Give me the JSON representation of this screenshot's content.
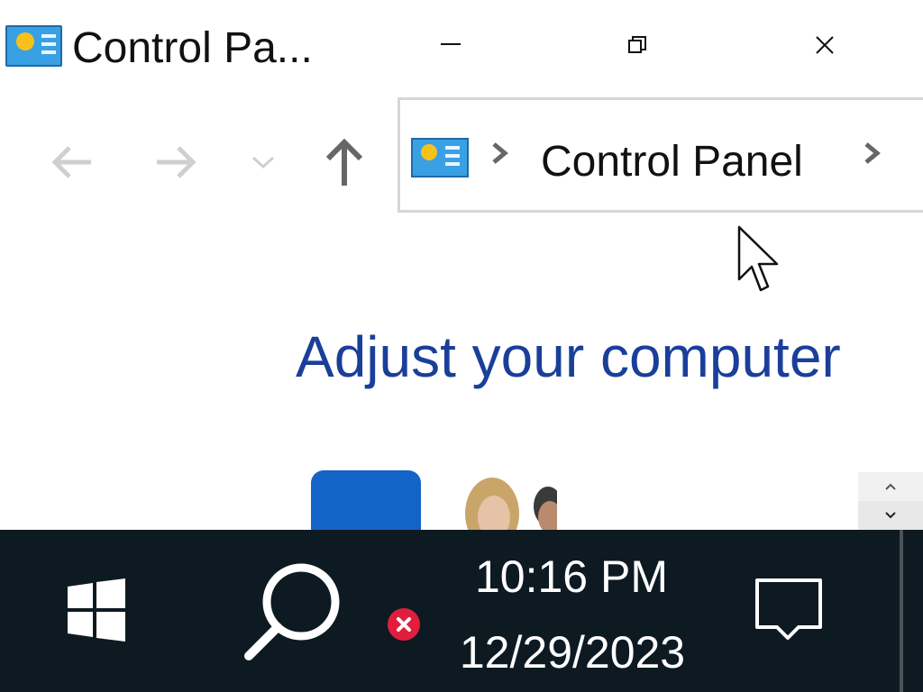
{
  "window": {
    "title": "Control Pa...",
    "minimize_icon": "minimize-icon",
    "restore_icon": "restore-icon",
    "close_icon": "close-icon"
  },
  "nav": {
    "back_icon": "arrow-left-icon",
    "forward_icon": "arrow-right-icon",
    "recent_icon": "chevron-down-icon",
    "up_icon": "arrow-up-icon"
  },
  "address_bar": {
    "icon": "control-panel-icon",
    "breadcrumb": "Control Panel"
  },
  "main": {
    "heading": "Adjust your computer"
  },
  "taskbar": {
    "time": "10:16 PM",
    "date": "12/29/2023",
    "background": "#0d1a22"
  },
  "colors": {
    "heading": "#1a3f9a",
    "shield": "#1463c7",
    "error_badge": "#e01e3c"
  }
}
